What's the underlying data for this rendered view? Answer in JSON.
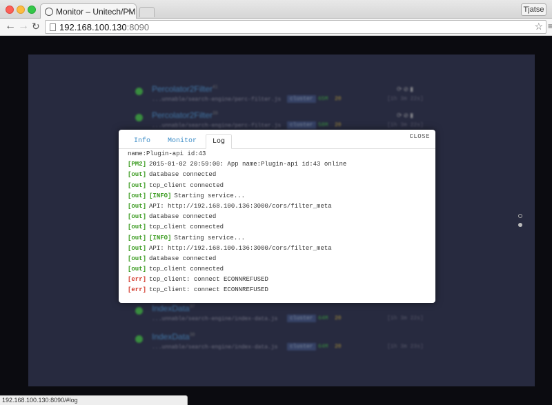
{
  "browser": {
    "tab_title": "Monitor – Unitech/PM2",
    "user": "Tjatse",
    "url_host": "192.168.100.130",
    "url_port": ":8090",
    "status_url": "192.168.100.130:8090/#log"
  },
  "processes": [
    {
      "name": "Percolator2Filter",
      "id": "41",
      "path": "...unnable/search-engine/perc-filter.js",
      "mode": "cluster",
      "mem": "65M",
      "cpu": "20",
      "uptime": "[1h 3m 22s]"
    },
    {
      "name": "Percolator2Filter",
      "id": "39",
      "path": "...unnable/search-engine/perc-filter.js",
      "mode": "cluster",
      "mem": "58M",
      "cpu": "20",
      "uptime": "[1h 3m 22s]"
    },
    {
      "name": "IndexData",
      "id": "37",
      "path": "...unnable/search-engine/index-data.js",
      "mode": "cluster",
      "mem": "64M",
      "cpu": "20",
      "uptime": "[1h 3m 22s]"
    },
    {
      "name": "IndexData",
      "id": "38",
      "path": "...unnable/search-engine/index-data.js",
      "mode": "cluster",
      "mem": "64M",
      "cpu": "20",
      "uptime": "[1h 3m 23s]"
    }
  ],
  "modal": {
    "tabs": [
      "Info",
      "Monitor",
      "Log"
    ],
    "active_tab": "Log",
    "close_label": "CLOSE",
    "log_lines": [
      {
        "tag": "",
        "text": "name:Plugin-api id:43"
      },
      {
        "tag": "[PM2]",
        "text": "2015-01-02 20:59:00: App name:Plugin-api id:43 online"
      },
      {
        "tag": "[out]",
        "text": "database connected"
      },
      {
        "tag": "[out]",
        "text": "tcp_client connected"
      },
      {
        "tag": "[out]",
        "info": "[INFO]",
        "text": "Starting service..."
      },
      {
        "tag": "[out]",
        "text": "API: http://192.168.100.136:3000/cors/filter_meta"
      },
      {
        "tag": "[out]",
        "text": "database connected"
      },
      {
        "tag": "[out]",
        "text": "tcp_client connected"
      },
      {
        "tag": "[out]",
        "info": "[INFO]",
        "text": "Starting service..."
      },
      {
        "tag": "[out]",
        "text": "API: http://192.168.100.136:3000/cors/filter_meta"
      },
      {
        "tag": "[out]",
        "text": "database connected"
      },
      {
        "tag": "[out]",
        "text": "tcp_client connected"
      },
      {
        "tag": "[err]",
        "text": "tcp_client: connect ECONNREFUSED"
      },
      {
        "tag": "[err]",
        "text": "tcp_client: connect ECONNREFUSED"
      }
    ]
  },
  "colors": {
    "pm2": "#3a9b1f",
    "out": "#3a9b1f",
    "err": "#d33a2c",
    "info": "#3a9b1f",
    "link": "#3a8bc6",
    "dashboard": "#272a3f"
  }
}
